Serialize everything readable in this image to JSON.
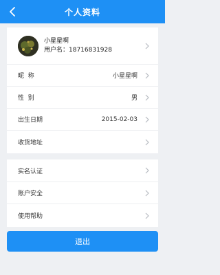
{
  "header": {
    "title": "个人资料",
    "back_icon": "chevron-left-icon"
  },
  "profile": {
    "avatar": "avatar-image",
    "nickname": "小星星啊",
    "username_line": "用户名：18716831928"
  },
  "info_rows": [
    {
      "label": "昵  称",
      "value": "小星星啊"
    },
    {
      "label": "性  别",
      "value": "男"
    },
    {
      "label": "出生日期",
      "value": "2015-02-03"
    },
    {
      "label": "收货地址",
      "value": ""
    }
  ],
  "settings_rows": [
    {
      "label": "实名认证"
    },
    {
      "label": "账户安全"
    },
    {
      "label": "使用帮助"
    }
  ],
  "logout": {
    "label": "退出"
  },
  "colors": {
    "primary": "#1e90f5",
    "background": "#eef0f3",
    "chevron": "#b8bcc2"
  }
}
